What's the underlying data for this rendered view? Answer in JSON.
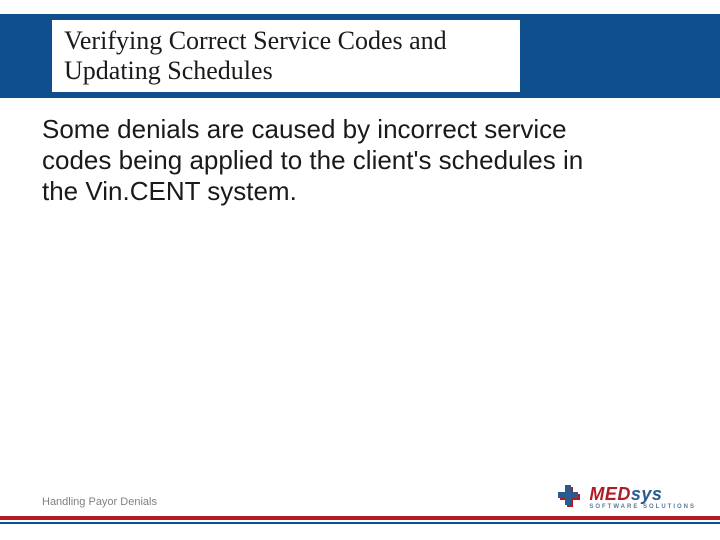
{
  "title": "Verifying Correct Service Codes and Updating Schedules",
  "body": "Some denials are caused by incorrect service codes being applied to the client's schedules in the Vin.CENT system.",
  "footer": "Handling Payor Denials",
  "logo": {
    "part1": "MED",
    "part2": "sys",
    "tagline": "SOFTWARE SOLUTIONS"
  },
  "colors": {
    "brand_blue": "#104f8e",
    "brand_red": "#b01b24"
  }
}
